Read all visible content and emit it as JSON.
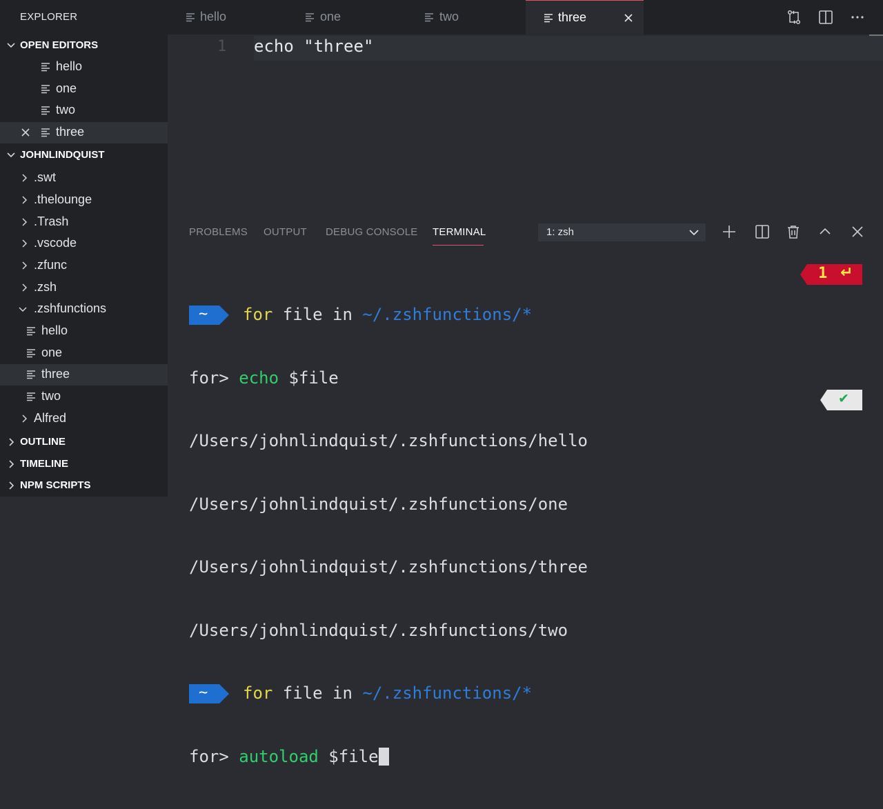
{
  "sidebar": {
    "title": "EXPLORER",
    "open_editors": {
      "header": "OPEN EDITORS",
      "items": [
        {
          "label": "hello"
        },
        {
          "label": "one"
        },
        {
          "label": "two"
        },
        {
          "label": "three"
        }
      ]
    },
    "workspace": {
      "header": "JOHNLINDQUIST",
      "folders_top": [
        ".swt",
        ".thelounge",
        ".Trash",
        ".vscode",
        ".zfunc",
        ".zsh",
        ".zshfunctions"
      ],
      "zshfunctions_children": [
        "hello",
        "one",
        "three",
        "two"
      ],
      "folders_bottom": [
        "Alfred"
      ]
    },
    "outline": "OUTLINE",
    "timeline": "TIMELINE",
    "npm_scripts": "NPM SCRIPTS"
  },
  "tabs": [
    {
      "label": "hello"
    },
    {
      "label": "one"
    },
    {
      "label": "two"
    },
    {
      "label": "three",
      "active": true
    }
  ],
  "editor": {
    "line_number": "1",
    "code": "echo \"three\""
  },
  "panel": {
    "tabs": [
      "PROBLEMS",
      "OUTPUT",
      "DEBUG CONSOLE",
      "TERMINAL"
    ],
    "active_tab": "TERMINAL",
    "terminal_select": "1: zsh"
  },
  "terminal": {
    "prompt_dir": "~",
    "line1": {
      "kw1": "for",
      "mid": " file in ",
      "path": "~/.zshfunctions/*"
    },
    "line2": {
      "prefix": "for> ",
      "cmd": "echo",
      "rest": " $file"
    },
    "outputs": [
      "/Users/johnlindquist/.zshfunctions/hello",
      "/Users/johnlindquist/.zshfunctions/one",
      "/Users/johnlindquist/.zshfunctions/three",
      "/Users/johnlindquist/.zshfunctions/two"
    ],
    "line3": {
      "kw1": "for",
      "mid": " file in ",
      "path": "~/.zshfunctions/*"
    },
    "line4": {
      "prefix": "for> ",
      "cmd": "autoload",
      "rest": " $file"
    },
    "error_status": "1",
    "error_symbol": "↵",
    "ok_symbol": "✔"
  },
  "colors": {
    "accent": "#e05561",
    "prompt_blue": "#1f6fd0",
    "keyword_yellow": "#e5d74a",
    "command_green": "#2fcf6c",
    "path_blue": "#2f7ddb",
    "error_red": "#c8102e"
  }
}
